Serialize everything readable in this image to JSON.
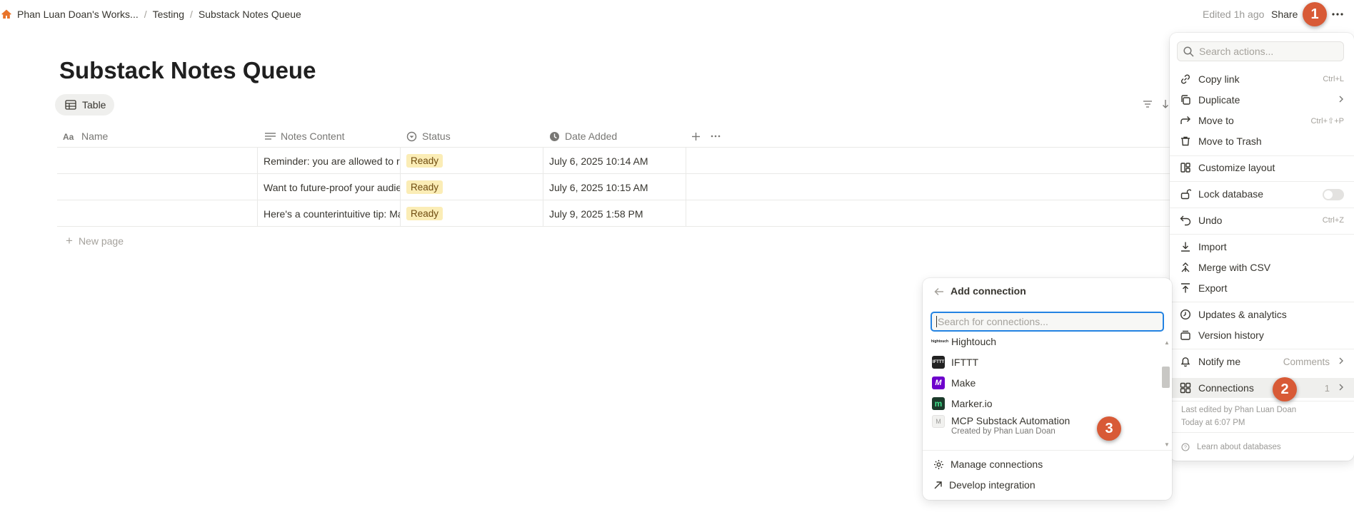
{
  "breadcrumb": {
    "workspace": "Phan Luan Doan's Works...",
    "parent": "Testing",
    "current": "Substack Notes Queue",
    "separator": "/"
  },
  "topbar": {
    "edited": "Edited 1h ago",
    "share": "Share"
  },
  "page": {
    "title": "Substack Notes Queue",
    "view_tab": "Table"
  },
  "table": {
    "columns": [
      "Name",
      "Notes Content",
      "Status",
      "Date Added"
    ],
    "rows": [
      {
        "name": "",
        "notes": "Reminder: you are allowed to re",
        "status": "Ready",
        "date": "July 6, 2025 10:14 AM"
      },
      {
        "name": "",
        "notes": "Want to future-proof your audie",
        "status": "Ready",
        "date": "July 6, 2025 10:15 AM"
      },
      {
        "name": "",
        "notes": "Here's a counterintuitive tip: Ma",
        "status": "Ready",
        "date": "July 9, 2025 1:58 PM"
      }
    ],
    "new_page": "New page"
  },
  "actions_menu": {
    "search_placeholder": "Search actions...",
    "items": [
      {
        "label": "Copy link",
        "shortcut": "Ctrl+L",
        "icon": "link-icon"
      },
      {
        "label": "Duplicate",
        "shortcut": "",
        "icon": "duplicate-icon"
      },
      {
        "label": "Move to",
        "shortcut": "Ctrl+⇧+P",
        "icon": "move-icon"
      },
      {
        "label": "Move to Trash",
        "shortcut": "",
        "icon": "trash-icon"
      },
      {
        "label": "Customize layout",
        "shortcut": "",
        "icon": "layout-icon"
      },
      {
        "label": "Lock database",
        "shortcut": "",
        "icon": "lock-icon"
      },
      {
        "label": "Undo",
        "shortcut": "Ctrl+Z",
        "icon": "undo-icon"
      },
      {
        "label": "Import",
        "shortcut": "",
        "icon": "import-icon"
      },
      {
        "label": "Merge with CSV",
        "shortcut": "",
        "icon": "merge-icon"
      },
      {
        "label": "Export",
        "shortcut": "",
        "icon": "export-icon"
      },
      {
        "label": "Updates & analytics",
        "shortcut": "",
        "icon": "analytics-icon"
      },
      {
        "label": "Version history",
        "shortcut": "",
        "icon": "history-icon"
      },
      {
        "label": "Notify me",
        "shortcut": "Comments",
        "icon": "bell-icon"
      },
      {
        "label": "Connections",
        "shortcut": "1",
        "icon": "connections-icon"
      }
    ],
    "last_edited_by": "Last edited by Phan Luan Doan",
    "last_edited_at": "Today at 6:07 PM",
    "learn": "Learn about databases"
  },
  "connections_popup": {
    "title": "Add connection",
    "search_placeholder": "Search for connections...",
    "items": [
      {
        "name": "Hightouch",
        "subtitle": "",
        "logo_text": "hightouch",
        "color": "#ffffff"
      },
      {
        "name": "IFTTT",
        "subtitle": "",
        "logo_text": "IFTTT",
        "color": "#222222"
      },
      {
        "name": "Make",
        "subtitle": "",
        "logo_text": "M",
        "color": "#6d00cc"
      },
      {
        "name": "Marker.io",
        "subtitle": "",
        "logo_text": "m",
        "color": "#1b8d5a"
      },
      {
        "name": "MCP Substack Automation",
        "subtitle": "Created by Phan Luan Doan",
        "logo_text": "M",
        "color": "#f1f1ef"
      }
    ],
    "footer": [
      "Manage connections",
      "Develop integration"
    ]
  },
  "badges": [
    "1",
    "2",
    "3"
  ],
  "colors": {
    "badge": "#d85a36",
    "status_tag_bg": "#fbedb6",
    "focus_ring": "#2383e2"
  }
}
